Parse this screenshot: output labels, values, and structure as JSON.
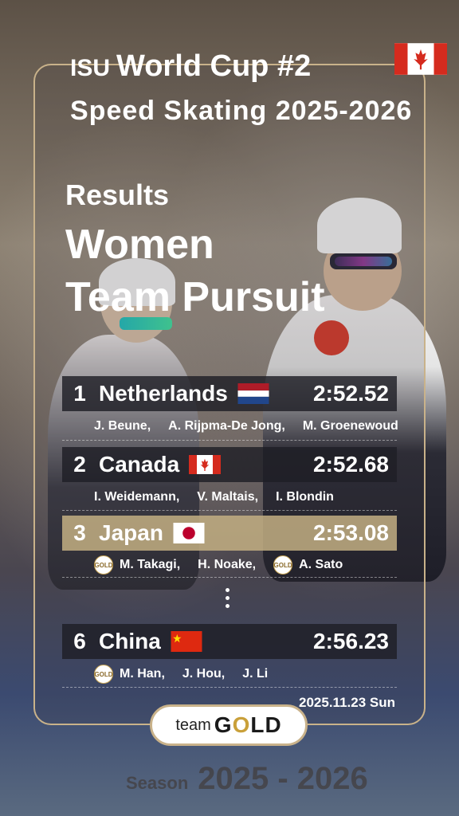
{
  "header": {
    "isu": "ISU",
    "world_cup": "World Cup #2",
    "subtitle": "Speed Skating 2025-2026"
  },
  "event": {
    "results_label": "Results",
    "line1": "Women",
    "line2": "Team Pursuit"
  },
  "results": [
    {
      "rank": "1",
      "country": "Netherlands",
      "time": "2:52.52",
      "members": [
        "J. Beune,",
        "A. Rijpma-De Jong,",
        "M. Groenewoud"
      ],
      "flag": "netherlands-flag"
    },
    {
      "rank": "2",
      "country": "Canada",
      "time": "2:52.68",
      "members": [
        "I. Weidemann,",
        "V. Maltais,",
        "I. Blondin"
      ],
      "flag": "canada-flag"
    },
    {
      "rank": "3",
      "country": "Japan",
      "time": "2:53.08",
      "members": [
        "M. Takagi,",
        "H. Noake,",
        "A. Sato"
      ],
      "flag": "japan-flag"
    },
    {
      "rank": "6",
      "country": "China",
      "time": "2:56.23",
      "members": [
        "M. Han,",
        "J. Hou,",
        "J. Li"
      ],
      "flag": "china-flag"
    }
  ],
  "date": "2025.11.23 Sun",
  "logo": {
    "team": "team",
    "gold_g": "G",
    "gold_o": "O",
    "gold_ld": "LD"
  },
  "badge_text": "GOLD",
  "season": {
    "label": "Season",
    "years": "2025 - 2026"
  },
  "colors": {
    "frame": "#c9b28a",
    "dark_row": "#1e1e26",
    "gold_row": "#c3af82"
  }
}
